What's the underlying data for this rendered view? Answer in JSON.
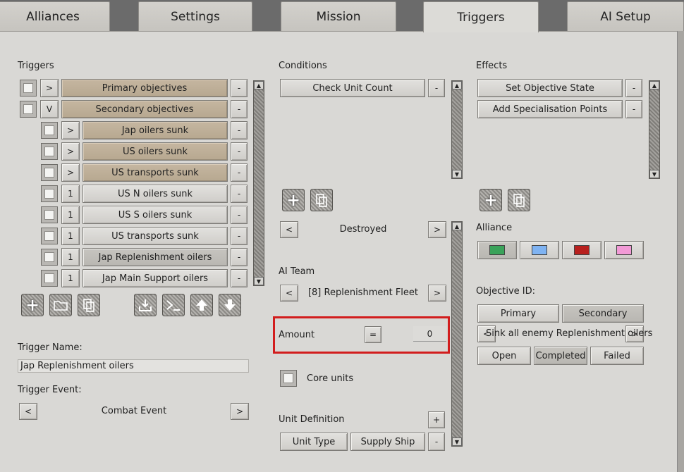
{
  "tabs": [
    "Alliances",
    "Settings",
    "Mission",
    "Triggers",
    "AI Setup"
  ],
  "triggers_panel": {
    "header": "Triggers",
    "rows": [
      {
        "toggle": ">",
        "label": "Primary objectives",
        "minus": "-"
      },
      {
        "toggle": "V",
        "label": "Secondary objectives",
        "minus": "-"
      },
      {
        "toggle": ">",
        "label": "Jap oilers sunk",
        "minus": "-"
      },
      {
        "toggle": ">",
        "label": "US oilers sunk",
        "minus": "-"
      },
      {
        "toggle": ">",
        "label": "US transports sunk",
        "minus": "-"
      },
      {
        "toggle": "1",
        "label": "US N oilers sunk",
        "minus": "-"
      },
      {
        "toggle": "1",
        "label": "US S oilers sunk",
        "minus": "-"
      },
      {
        "toggle": "1",
        "label": "US transports sunk",
        "minus": "-"
      },
      {
        "toggle": "1",
        "label": "Jap Replenishment oilers",
        "minus": "-"
      },
      {
        "toggle": "1",
        "label": "Jap Main Support oilers",
        "minus": "-"
      }
    ],
    "trigger_name_label": "Trigger Name:",
    "trigger_name_value": "Jap Replenishment oilers",
    "trigger_event_label": "Trigger Event:",
    "trigger_event_value": "Combat Event",
    "prev": "<",
    "next": ">"
  },
  "conditions_panel": {
    "header": "Conditions",
    "items": [
      {
        "label": "Check Unit Count",
        "minus": "-"
      }
    ],
    "destroyed": "Destroyed",
    "ai_team_label": "AI Team",
    "ai_team_value": "[8] Replenishment Fleet",
    "amount_label": "Amount",
    "amount_op": "=",
    "amount_value": "0",
    "core_units_label": "Core units",
    "unit_definition_label": "Unit Definition",
    "unit_def_plus": "+",
    "unit_type_label": "Unit Type",
    "unit_type_value": "Supply Ship",
    "minus": "-",
    "prev": "<",
    "next": ">"
  },
  "effects_panel": {
    "header": "Effects",
    "items": [
      {
        "label": "Set Objective State",
        "minus": "-"
      },
      {
        "label": "Add Specialisation Points",
        "minus": "-"
      }
    ],
    "alliance_label": "Alliance",
    "alliance_colors": [
      "#3aa35a",
      "#7fb3f2",
      "#b8201e",
      "#f29ad6"
    ],
    "objective_id_label": "Objective ID:",
    "primary": "Primary",
    "secondary": "Secondary",
    "objective_text": "Sink all enemy Replenishment oilers",
    "prev": "<",
    "next": ">",
    "states": [
      "Open",
      "Completed",
      "Failed"
    ]
  }
}
